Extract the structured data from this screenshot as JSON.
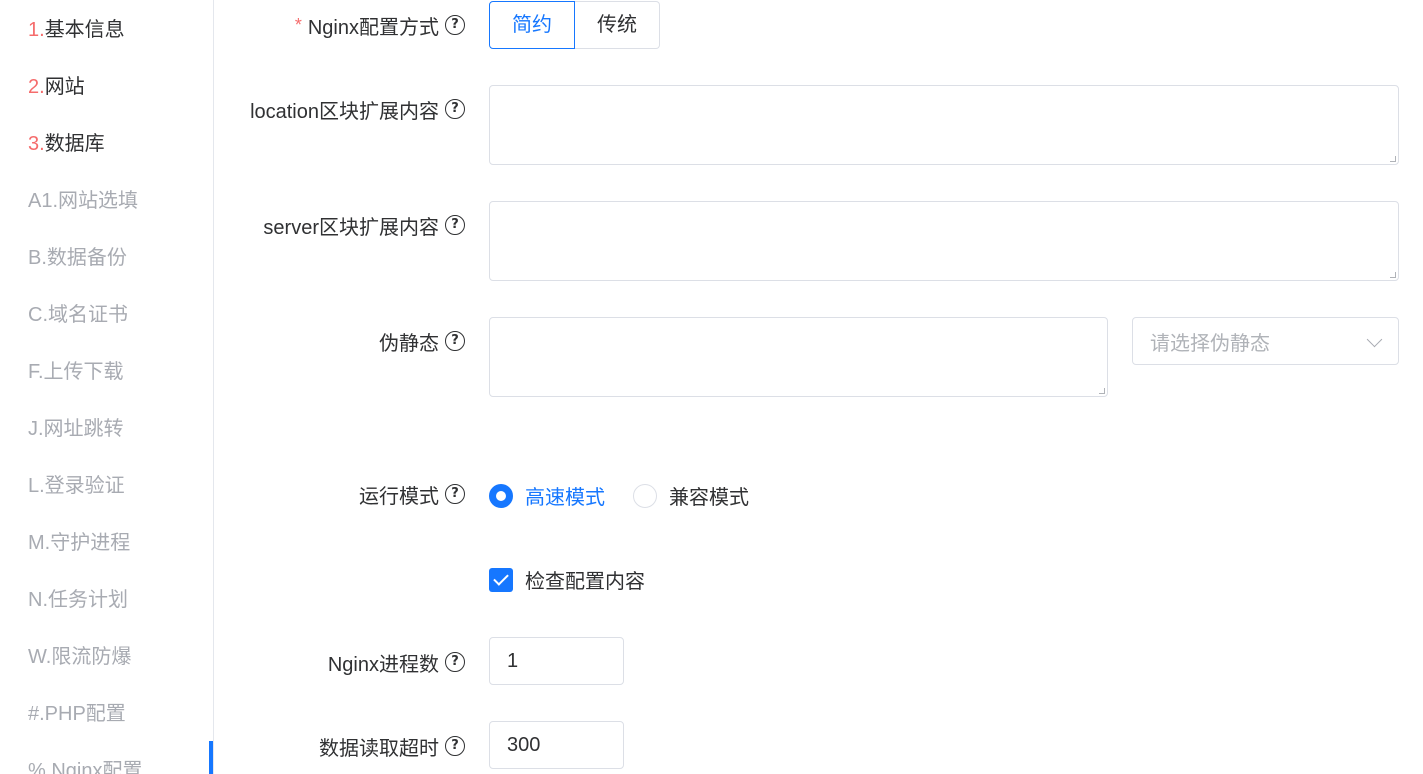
{
  "sidebar": {
    "items": [
      {
        "num": "1.",
        "label": "基本信息"
      },
      {
        "num": "2.",
        "label": "网站"
      },
      {
        "num": "3.",
        "label": "数据库"
      },
      {
        "label": "A1.网站选填"
      },
      {
        "label": "B.数据备份"
      },
      {
        "label": "C.域名证书"
      },
      {
        "label": "F.上传下载"
      },
      {
        "label": "J.网址跳转"
      },
      {
        "label": "L.登录验证"
      },
      {
        "label": "M.守护进程"
      },
      {
        "label": "N.任务计划"
      },
      {
        "label": "W.限流防爆"
      },
      {
        "label": "#.PHP配置"
      },
      {
        "label": "%.Nginx配置"
      }
    ]
  },
  "form": {
    "config_mode": {
      "required_mark": "*",
      "label": "Nginx配置方式",
      "options": [
        "简约",
        "传统"
      ],
      "selected": "简约"
    },
    "location_ext": {
      "label": "location区块扩展内容",
      "value": ""
    },
    "server_ext": {
      "label": "server区块扩展内容",
      "value": ""
    },
    "rewrite": {
      "label": "伪静态",
      "value": "",
      "select_placeholder": "请选择伪静态"
    },
    "run_mode": {
      "label": "运行模式",
      "options": [
        "高速模式",
        "兼容模式"
      ],
      "selected": "高速模式"
    },
    "check_config": {
      "label": "检查配置内容",
      "checked": true
    },
    "worker_processes": {
      "label": "Nginx进程数",
      "value": "1"
    },
    "read_timeout": {
      "label": "数据读取超时",
      "value": "300"
    }
  },
  "icons": {
    "help": "question-circle-icon"
  },
  "colors": {
    "primary": "#1677ff",
    "required": "#f56c6c",
    "muted": "#a8abb2"
  }
}
